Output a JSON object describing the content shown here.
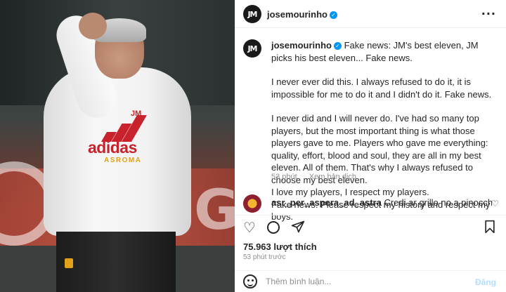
{
  "header": {
    "avatar_text": "JM",
    "username": "josemourinho",
    "verified_mark": "✓",
    "more_icon": "ellipsis-icon"
  },
  "photo": {
    "jm_mark": "JM",
    "brand": "adidas",
    "club": "ASROMA"
  },
  "caption": {
    "avatar_text": "JM",
    "username": "josemourinho",
    "verified_mark": "✓",
    "paragraph_1": "Fake news: JM's best eleven, JM picks his best eleven... Fake news.",
    "paragraph_2": "I never ever did this. I always refused to do it, it is impossible for me to do it and I didn't do it. Fake news.",
    "paragraph_3": "I never did and I will never do. I've had so many top players, but the most important thing is what those players gave to me. Players who gave me everything: quality, effort, blood and soul, they are all in my best eleven. All of them. That's why I always refused to choose my best eleven.",
    "paragraph_4": "I love my players, I respect my players.",
    "paragraph_5": "Fake news. Please respect my history and respect my boys.",
    "time": "53 phút",
    "translate_label": "Xem bản dịch"
  },
  "comment": {
    "username": "asr_per_aspera_ad_astra",
    "text": "Credi ar grillo no a pinocchio.... avanti",
    "heart_icon": "heart-icon"
  },
  "actions": {
    "like_icon": "heart-icon",
    "comment_icon": "comment-icon",
    "share_icon": "share-icon",
    "save_icon": "bookmark-icon"
  },
  "likes": "75.963 lượt thích",
  "timestamp": "53 phút trước",
  "comment_box": {
    "placeholder": "Thêm bình luận...",
    "post_label": "Đăng"
  }
}
